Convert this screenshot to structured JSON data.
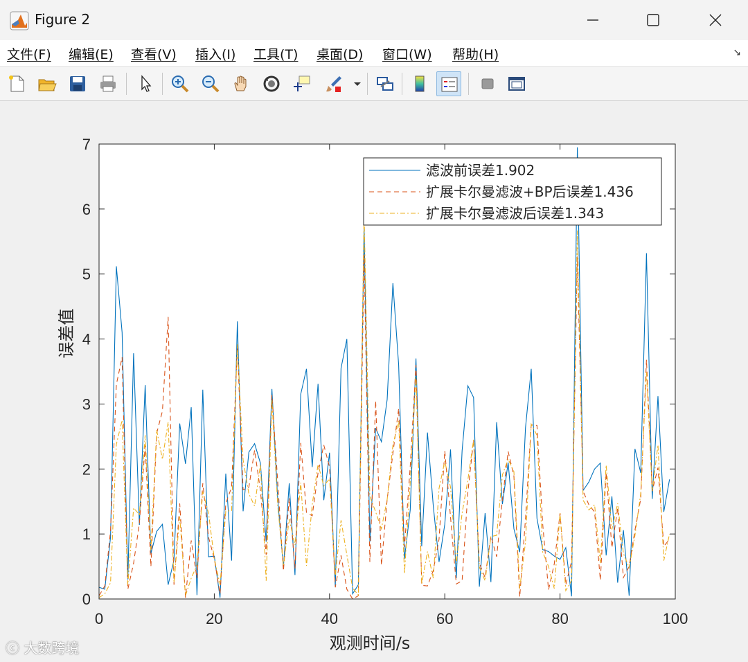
{
  "window": {
    "title": "Figure 2",
    "minimize_icon": "minimize-icon",
    "maximize_icon": "maximize-icon",
    "close_icon": "close-icon"
  },
  "menu": {
    "items": [
      "文件(F)",
      "编辑(E)",
      "查看(V)",
      "插入(I)",
      "工具(T)",
      "桌面(D)",
      "窗口(W)",
      "帮助(H)"
    ]
  },
  "toolbar": {
    "icons": [
      "new-figure-icon",
      "open-icon",
      "save-icon",
      "print-icon",
      "pointer-icon",
      "zoom-in-icon",
      "zoom-out-icon",
      "pan-icon",
      "rotate-icon",
      "data-cursor-icon",
      "brush-icon",
      "link-icon",
      "colorbar-icon",
      "legend-icon",
      "hide-tools-icon",
      "dock-icon"
    ]
  },
  "watermark": "大数跨境",
  "colors": {
    "series1": "#0072BD",
    "series2": "#D95319",
    "series3": "#EDB120"
  },
  "chart_data": {
    "type": "line",
    "xlabel": "观测时间/s",
    "ylabel": "误差值",
    "xlim": [
      0,
      100
    ],
    "ylim": [
      0,
      7
    ],
    "xticks": [
      0,
      20,
      40,
      60,
      80,
      100
    ],
    "yticks": [
      0,
      1,
      2,
      3,
      4,
      5,
      6,
      7
    ],
    "legend_position": "top-right",
    "grid": false,
    "x": [
      0,
      1,
      2,
      3,
      4,
      5,
      6,
      7,
      8,
      9,
      10,
      11,
      12,
      13,
      14,
      15,
      16,
      17,
      18,
      19,
      20,
      21,
      22,
      23,
      24,
      25,
      26,
      27,
      28,
      29,
      30,
      31,
      32,
      33,
      34,
      35,
      36,
      37,
      38,
      39,
      40,
      41,
      42,
      43,
      44,
      45,
      46,
      47,
      48,
      49,
      50,
      51,
      52,
      53,
      54,
      55,
      56,
      57,
      58,
      59,
      60,
      61,
      62,
      63,
      64,
      65,
      66,
      67,
      68,
      69,
      70,
      71,
      72,
      73,
      74,
      75,
      76,
      77,
      78,
      79,
      80,
      81,
      82,
      83,
      84,
      85,
      86,
      87,
      88,
      89,
      90,
      91,
      92,
      93,
      94,
      95,
      96,
      97,
      98,
      99
    ],
    "series": [
      {
        "name": "滤波前误差1.902",
        "style": "solid",
        "values": [
          0.18,
          0.15,
          0.95,
          5.12,
          4.1,
          0.3,
          3.78,
          1.14,
          3.29,
          0.7,
          1.04,
          1.15,
          0.22,
          0.6,
          2.7,
          2.08,
          2.95,
          0.06,
          3.22,
          0.65,
          0.66,
          0.02,
          1.93,
          0.59,
          4.27,
          1.35,
          2.26,
          2.39,
          2.09,
          0.88,
          3.23,
          1.55,
          0.48,
          1.78,
          0.37,
          3.15,
          3.54,
          2.03,
          3.31,
          1.52,
          2.25,
          0.18,
          3.55,
          4.0,
          0.08,
          0.22,
          5.7,
          0.88,
          2.63,
          2.42,
          3.07,
          4.86,
          3.6,
          0.62,
          1.37,
          3.7,
          0.81,
          2.56,
          1.43,
          0.57,
          1.15,
          2.3,
          0.32,
          2.28,
          3.28,
          3.1,
          0.19,
          1.32,
          0.26,
          2.72,
          1.46,
          2.1,
          1.08,
          0.72,
          2.63,
          3.54,
          1.24,
          0.76,
          0.73,
          0.66,
          0.61,
          0.79,
          0.04,
          6.95,
          1.67,
          1.8,
          2.0,
          2.09,
          0.67,
          1.58,
          0.25,
          1.06,
          0.05,
          2.31,
          1.94,
          5.32,
          1.54,
          3.12,
          1.34,
          1.84,
          2.07,
          3.17
        ]
      },
      {
        "name": "扩展卡尔曼滤波+BP后误差1.436",
        "style": "dashed",
        "values": [
          0.05,
          0.2,
          1.05,
          3.3,
          3.72,
          0.15,
          0.55,
          1.16,
          2.36,
          0.5,
          2.55,
          2.89,
          4.34,
          0.22,
          1.47,
          0.02,
          0.9,
          0.32,
          1.78,
          0.95,
          0.62,
          0.08,
          1.47,
          1.72,
          3.9,
          1.68,
          1.72,
          2.29,
          1.67,
          0.68,
          3.14,
          1.82,
          0.43,
          1.55,
          0.47,
          2.4,
          1.33,
          1.28,
          1.94,
          2.37,
          2.03,
          0.18,
          0.67,
          0.15,
          0.0,
          0.05,
          5.3,
          0.57,
          3.05,
          0.52,
          1.53,
          2.24,
          2.93,
          0.8,
          2.04,
          3.6,
          0.21,
          0.2,
          0.44,
          0.92,
          2.28,
          1.26,
          0.23,
          0.28,
          1.64,
          2.45,
          0.55,
          0.33,
          0.97,
          0.65,
          1.53,
          2.27,
          1.89,
          0.03,
          1.23,
          2.68,
          2.67,
          1.15,
          0.14,
          0.54,
          1.32,
          0.22,
          0.58,
          5.27,
          1.66,
          1.45,
          1.34,
          0.29,
          1.94,
          0.79,
          1.4,
          0.33,
          0.5,
          1.06,
          1.54,
          3.68,
          1.66,
          2.02,
          0.81,
          0.92,
          0.03,
          1.9
        ]
      },
      {
        "name": "扩展卡尔曼滤波后误差1.343",
        "style": "dashdot",
        "values": [
          0.02,
          0.08,
          0.25,
          2.38,
          2.75,
          0.22,
          1.4,
          1.3,
          2.52,
          0.75,
          2.6,
          2.15,
          2.72,
          0.25,
          1.27,
          0.05,
          0.32,
          0.52,
          1.65,
          1.32,
          0.62,
          0.22,
          1.35,
          1.36,
          3.92,
          2.14,
          1.62,
          1.43,
          2.07,
          0.28,
          3.07,
          1.45,
          0.51,
          1.23,
          0.83,
          1.79,
          0.51,
          1.45,
          2.07,
          1.74,
          1.85,
          0.36,
          1.21,
          0.68,
          0.17,
          0.06,
          5.95,
          1.58,
          1.34,
          1.08,
          1.53,
          2.37,
          2.74,
          0.39,
          1.8,
          3.43,
          0.23,
          0.73,
          0.32,
          1.7,
          2.12,
          1.72,
          0.54,
          1.32,
          1.83,
          2.45,
          0.49,
          0.28,
          0.96,
          0.98,
          1.91,
          2.15,
          1.96,
          0.16,
          0.87,
          2.69,
          2.52,
          0.72,
          0.5,
          0.16,
          1.32,
          0.13,
          0.28,
          5.67,
          1.52,
          1.37,
          1.45,
          0.55,
          2.06,
          1.07,
          1.47,
          0.7,
          0.48,
          0.98,
          1.62,
          3.49,
          1.66,
          2.37,
          0.59,
          1.0,
          0.53,
          1.49
        ]
      }
    ]
  }
}
